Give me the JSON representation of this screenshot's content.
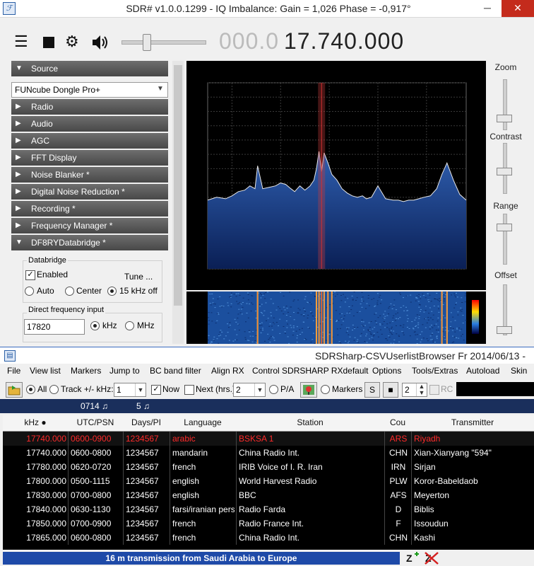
{
  "sdr": {
    "title": "SDR# v1.0.0.1299 - IQ Imbalance: Gain = 1,026 Phase = -0,917°",
    "freq_dim": "000.0",
    "freq_main": "17.740.000",
    "volume_fraction": 0.3,
    "panel": {
      "source_label": "Source",
      "source_device": "FUNcube Dongle Pro+",
      "sections": [
        "Radio",
        "Audio",
        "AGC",
        "FFT Display",
        "Noise Blanker *",
        "Digital Noise Reduction *",
        "Recording *",
        "Frequency Manager *"
      ],
      "databridge_label": "DF8RYDatabridge *",
      "databridge_group": "Databridge",
      "enabled_label": "Enabled",
      "tune_label": "Tune ...",
      "auto_label": "Auto",
      "center_label": "Center",
      "offset_label": "15 kHz off",
      "direct_group": "Direct frequency input",
      "direct_value": "17820",
      "khz_label": "kHz",
      "mhz_label": "MHz"
    },
    "right_labels": {
      "zoom": "Zoom",
      "contrast": "Contrast",
      "range": "Range",
      "offset": "Offset"
    }
  },
  "chart_data": {
    "type": "line",
    "title": "",
    "xlabel": "",
    "ylabel": "",
    "xlim": [
      17.651,
      17.853
    ],
    "ylim": [
      -130,
      0
    ],
    "yticks": [
      "0",
      "-10",
      "-20",
      "-30",
      "-40",
      "-50",
      "-60",
      "-70",
      "-80",
      "-90",
      "-100",
      "-110",
      "-120",
      "-130"
    ],
    "xticks": [
      {
        "v": 17.67,
        "label": "17.670k"
      },
      {
        "v": 17.708,
        "label": "17.708k"
      },
      {
        "v": 17.746,
        "label": "17.746k"
      },
      {
        "v": 17.784,
        "label": "17.784k"
      },
      {
        "v": 17.822,
        "label": "17.822k"
      }
    ],
    "tuned": 17.74,
    "grid": true,
    "x": [
      17.651,
      17.658,
      17.665,
      17.67,
      17.675,
      17.68,
      17.684,
      17.688,
      17.69,
      17.694,
      17.699,
      17.704,
      17.708,
      17.712,
      17.716,
      17.719,
      17.723,
      17.727,
      17.731,
      17.734,
      17.736,
      17.738,
      17.74,
      17.742,
      17.745,
      17.748,
      17.752,
      17.756,
      17.76,
      17.764,
      17.768,
      17.772,
      17.775,
      17.779,
      17.784,
      17.79,
      17.796,
      17.8,
      17.804,
      17.808,
      17.812,
      17.816,
      17.82,
      17.825,
      17.83,
      17.834,
      17.838,
      17.843,
      17.848,
      17.853
    ],
    "values": [
      -82,
      -80,
      -81,
      -79,
      -76,
      -75,
      -72,
      -74,
      -58,
      -74,
      -73,
      -72,
      -70,
      -71,
      -74,
      -76,
      -72,
      -75,
      -72,
      -68,
      -60,
      -48,
      -62,
      -49,
      -56,
      -64,
      -68,
      -74,
      -77,
      -79,
      -80,
      -79,
      -81,
      -80,
      -72,
      -81,
      -82,
      -82,
      -83,
      -82,
      -82,
      -81,
      -80,
      -79,
      -74,
      -64,
      -56,
      -68,
      -78,
      -82
    ]
  },
  "csv": {
    "title": "SDRSharp-CSVUserlistBrowser Fr 2014/06/13 -",
    "menu": [
      "File",
      "View list",
      "Markers",
      "Jump to",
      "BC band filter",
      "Align RX",
      "Control SDRSHARP RXdefault",
      "Options",
      "Tools/Extras",
      "Autoload",
      "Skin"
    ],
    "toolbar": {
      "all_label": "All",
      "track_label": "Track +/- kHz:",
      "track_value": "1",
      "now_label": "Now",
      "next_label": "Next (hrs.):",
      "next_value": "2",
      "pa_label": "P/A",
      "markers_label": "Markers",
      "s_label": "S",
      "stop_label": "■",
      "num_value": "2",
      "rc_label": "RC"
    },
    "band": {
      "time": "0714 ♫",
      "count": "5 ♫"
    },
    "columns": [
      "kHz ●",
      "UTC/PSN",
      "Days/PI",
      "Language",
      "Station",
      "Cou",
      "Transmitter"
    ],
    "rows": [
      [
        "17740.000",
        "0600-0900",
        "1234567",
        "arabic",
        "BSKSA 1",
        "ARS",
        "Riyadh"
      ],
      [
        "17740.000",
        "0600-0800",
        "1234567",
        "mandarin",
        "China Radio Int.",
        "CHN",
        "Xian-Xianyang \"594\""
      ],
      [
        "17780.000",
        "0620-0720",
        "1234567",
        "french",
        "IRIB Voice of I. R. Iran",
        "IRN",
        "Sirjan"
      ],
      [
        "17800.000",
        "0500-1115",
        "1234567",
        "english",
        "World Harvest Radio",
        "PLW",
        "Koror-Babeldaob"
      ],
      [
        "17830.000",
        "0700-0800",
        "1234567",
        "english",
        "BBC",
        "AFS",
        "Meyerton"
      ],
      [
        "17840.000",
        "0630-1130",
        "1234567",
        "farsi/iranian pers",
        "Radio Farda",
        "D",
        "Biblis"
      ],
      [
        "17850.000",
        "0700-0900",
        "1234567",
        "french",
        "Radio France Int.",
        "F",
        "Issoudun"
      ],
      [
        "17865.000",
        "0600-0800",
        "1234567",
        "french",
        "China Radio Int.",
        "CHN",
        "Kashi"
      ]
    ],
    "status": "16 m transmission from Saudi Arabia to Europe",
    "colors": {
      "selected_row": "#ff2a2a",
      "row_text": "#ffffff",
      "band": "#1a2f5c",
      "status": "#1e4aa8"
    }
  }
}
